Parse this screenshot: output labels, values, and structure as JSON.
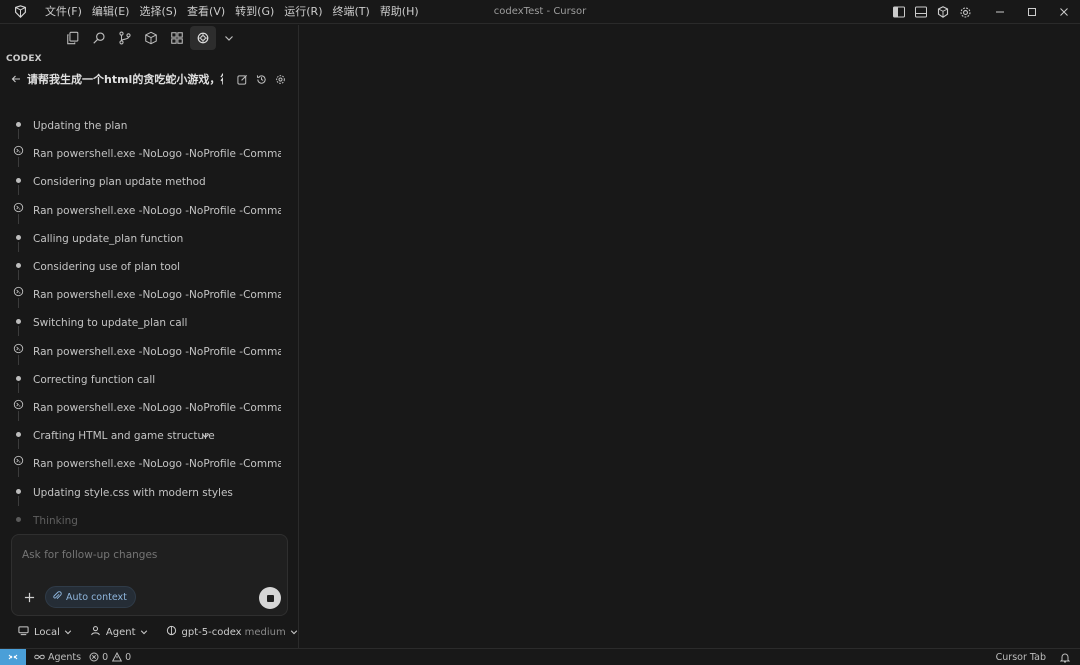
{
  "window": {
    "title": "codexTest - Cursor"
  },
  "menu": [
    "文件(F)",
    "编辑(E)",
    "选择(S)",
    "查看(V)",
    "转到(G)",
    "运行(R)",
    "终端(T)",
    "帮助(H)"
  ],
  "sidebar": {
    "section_title": "CODEX",
    "conversation_title": "请帮我生成一个html的贪吃蛇小游戏，符..."
  },
  "steps": [
    {
      "kind": "dot",
      "text": "Updating the plan"
    },
    {
      "kind": "terminal",
      "text": "Ran powershell.exe -NoLogo -NoProfile -Comman..."
    },
    {
      "kind": "dot",
      "text": "Considering plan update method"
    },
    {
      "kind": "terminal",
      "text": "Ran powershell.exe -NoLogo -NoProfile -Comman..."
    },
    {
      "kind": "dot",
      "text": "Calling update_plan function"
    },
    {
      "kind": "dot",
      "text": "Considering use of plan tool"
    },
    {
      "kind": "terminal",
      "text": "Ran powershell.exe -NoLogo -NoProfile -Comman..."
    },
    {
      "kind": "dot",
      "text": "Switching to update_plan call"
    },
    {
      "kind": "terminal",
      "text": "Ran powershell.exe -NoLogo -NoProfile -Comman..."
    },
    {
      "kind": "dot",
      "text": "Correcting function call"
    },
    {
      "kind": "terminal",
      "text": "Ran powershell.exe -NoLogo -NoProfile -Comman..."
    },
    {
      "kind": "dot",
      "text": "Crafting HTML and game structure",
      "expandable": true
    },
    {
      "kind": "terminal",
      "text": "Ran powershell.exe -NoLogo -NoProfile -Comman..."
    },
    {
      "kind": "dot",
      "text": "Updating style.css with modern styles"
    },
    {
      "kind": "dot",
      "text": "Thinking",
      "dim": true
    }
  ],
  "composer": {
    "placeholder": "Ask for follow-up changes",
    "context_label": "Auto context"
  },
  "footer": {
    "environment": "Local",
    "mode": "Agent",
    "model": "gpt-5-codex",
    "reasoning": "medium"
  },
  "statusbar": {
    "agents": "Agents",
    "errors": "0",
    "warnings": "0",
    "cursor_tab": "Cursor Tab"
  },
  "colors": {
    "accent": "#4a9fd8",
    "background": "#181818",
    "chip": "#252d36"
  }
}
